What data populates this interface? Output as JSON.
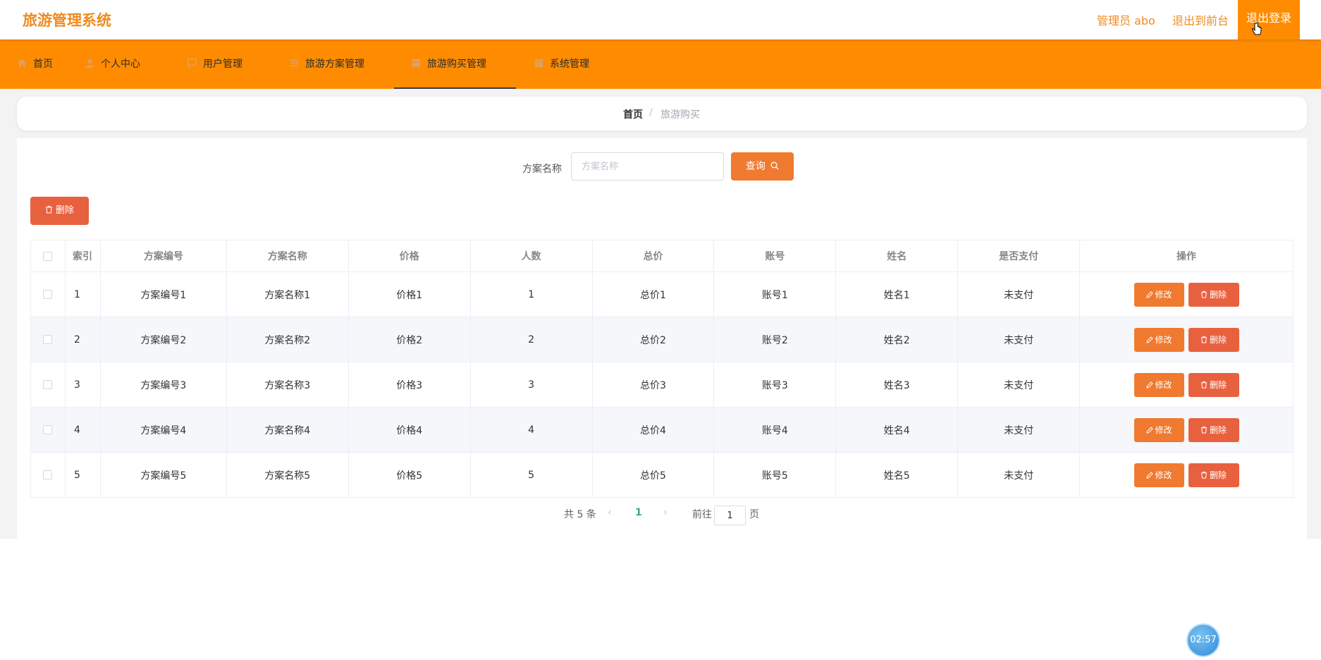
{
  "header": {
    "brand": "旅游管理系统",
    "user_label": "管理员 abo",
    "front_label": "退出到前台",
    "logout_label": "退出登录"
  },
  "nav": {
    "items": [
      {
        "label": "首页",
        "icon": "home-icon",
        "has_caret": false
      },
      {
        "label": "个人中心",
        "icon": "user-icon",
        "has_caret": true
      },
      {
        "label": "用户管理",
        "icon": "chat-icon",
        "has_caret": true
      },
      {
        "label": "旅游方案管理",
        "icon": "list-icon",
        "has_caret": false
      },
      {
        "label": "旅游购买管理",
        "icon": "grid-icon",
        "has_caret": true,
        "active": true
      },
      {
        "label": "系统管理",
        "icon": "grid-icon",
        "has_caret": true
      }
    ]
  },
  "breadcrumb": {
    "home": "首页",
    "separator": "/",
    "current": "旅游购买"
  },
  "search": {
    "label": "方案名称",
    "placeholder": "方案名称",
    "value": "",
    "button_label": "查询"
  },
  "toolbar": {
    "delete_label": "删除"
  },
  "table": {
    "columns": [
      "索引",
      "方案编号",
      "方案名称",
      "价格",
      "人数",
      "总价",
      "账号",
      "姓名",
      "是否支付",
      "操作"
    ],
    "rows": [
      [
        "1",
        "方案编号1",
        "方案名称1",
        "价格1",
        "1",
        "总价1",
        "账号1",
        "姓名1",
        "未支付"
      ],
      [
        "2",
        "方案编号2",
        "方案名称2",
        "价格2",
        "2",
        "总价2",
        "账号2",
        "姓名2",
        "未支付"
      ],
      [
        "3",
        "方案编号3",
        "方案名称3",
        "价格3",
        "3",
        "总价3",
        "账号3",
        "姓名3",
        "未支付"
      ],
      [
        "4",
        "方案编号4",
        "方案名称4",
        "价格4",
        "4",
        "总价4",
        "账号4",
        "姓名4",
        "未支付"
      ],
      [
        "5",
        "方案编号5",
        "方案名称5",
        "价格5",
        "5",
        "总价5",
        "账号5",
        "姓名5",
        "未支付"
      ]
    ],
    "edit_label": "修改",
    "delete_label": "删除"
  },
  "pagination": {
    "total_text": "共 5 条",
    "current_page": "1",
    "goto_prefix": "前往",
    "goto_value": "1",
    "goto_suffix": "页"
  },
  "timer": "02:57",
  "colors": {
    "brand": "#f08a1e",
    "nav_bg": "#ff8c00",
    "primary_btn": "#f07a30",
    "danger_btn": "#e8613f",
    "page_active": "#3aa68d"
  }
}
